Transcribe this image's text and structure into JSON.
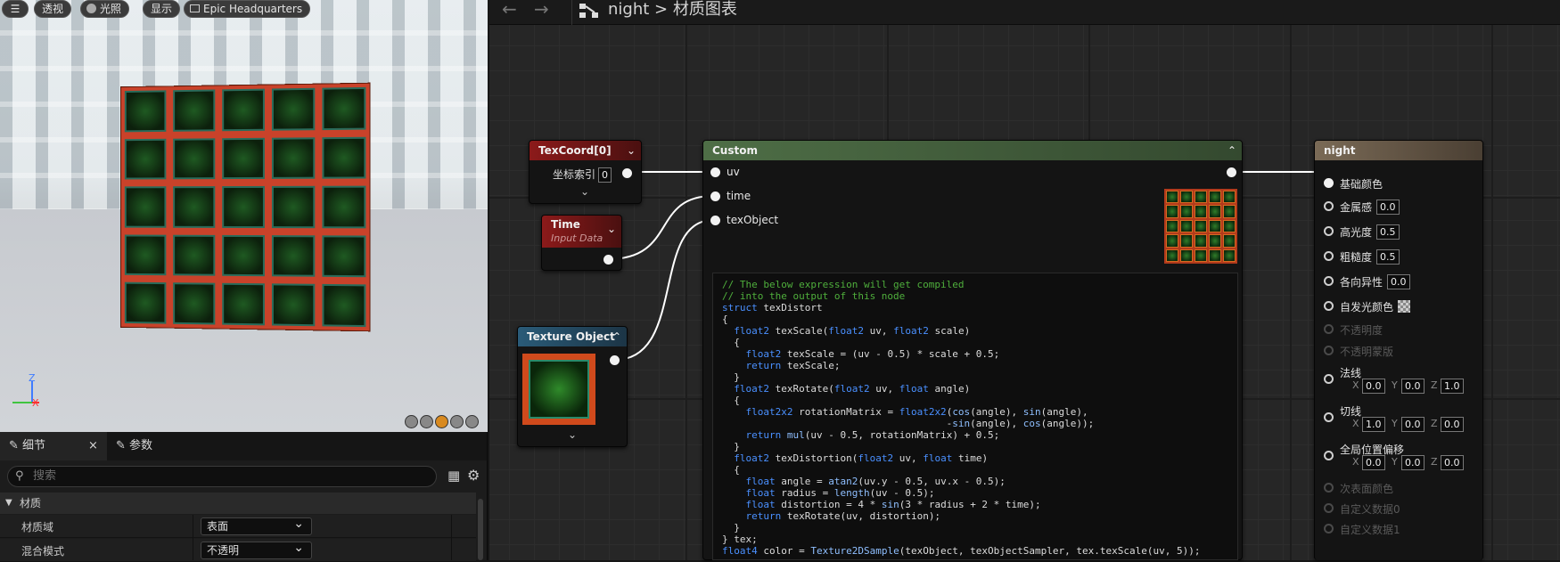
{
  "viewport": {
    "menu_icon": "hamburger-icon",
    "buttons": [
      "透视",
      "光照",
      "显示",
      "Epic Headquarters"
    ],
    "axis": {
      "z": "Z",
      "x": "X"
    }
  },
  "details": {
    "tabs": [
      "细节",
      "参数"
    ],
    "close": "×",
    "search_placeholder": "搜索",
    "category": "材质",
    "rows": [
      {
        "label": "材质域",
        "value": "表面"
      },
      {
        "label": "混合模式",
        "value": "不透明"
      }
    ]
  },
  "graph": {
    "breadcrumb_root": "night",
    "breadcrumb_sep": ">",
    "breadcrumb_current": "材质图表",
    "nodes": {
      "texcoord": {
        "title": "TexCoord[0]",
        "param": "坐标索引",
        "value": "0"
      },
      "time": {
        "title": "Time",
        "subtitle": "Input Data"
      },
      "texobj": {
        "title": "Texture Object"
      },
      "custom": {
        "title": "Custom",
        "inputs": [
          "uv",
          "time",
          "texObject"
        ]
      },
      "result": {
        "title": "night",
        "pins": [
          {
            "label": "基础颜色",
            "value": ""
          },
          {
            "label": "金属感",
            "value": "0.0"
          },
          {
            "label": "高光度",
            "value": "0.5"
          },
          {
            "label": "粗糙度",
            "value": "0.5"
          },
          {
            "label": "各向异性",
            "value": "0.0"
          },
          {
            "label": "自发光颜色",
            "value": ""
          },
          {
            "label": "不透明度",
            "value": ""
          },
          {
            "label": "不透明蒙版",
            "value": ""
          },
          {
            "label": "法线",
            "value": ""
          },
          {
            "label": "切线",
            "value": ""
          },
          {
            "label": "全局位置偏移",
            "value": ""
          },
          {
            "label": "次表面颜色",
            "value": ""
          },
          {
            "label": "自定义数据0",
            "value": ""
          },
          {
            "label": "自定义数据1",
            "value": ""
          }
        ],
        "normal_xyz": [
          "0.0",
          "0.0",
          "1.0"
        ],
        "tangent_xyz": [
          "1.0",
          "0.0",
          "0.0"
        ],
        "wpo_xyz": [
          "0.0",
          "0.0",
          "0.0"
        ],
        "xyz_labels": [
          "X",
          "Y",
          "Z"
        ]
      }
    },
    "code_lines": [
      "// The below expression will get compiled",
      "// into the output of this node",
      "struct texDistort",
      "{",
      "  float2 texScale(float2 uv, float2 scale)",
      "  {",
      "    float2 texScale = (uv - 0.5) * scale + 0.5;",
      "    return texScale;",
      "  }",
      "  float2 texRotate(float2 uv, float angle)",
      "  {",
      "    float2x2 rotationMatrix = float2x2(cos(angle), sin(angle),",
      "                                      -sin(angle), cos(angle));",
      "    return mul(uv - 0.5, rotationMatrix) + 0.5;",
      "  }",
      "  float2 texDistortion(float2 uv, float time)",
      "  {",
      "    float angle = atan2(uv.y - 0.5, uv.x - 0.5);",
      "    float radius = length(uv - 0.5);",
      "    float distortion = 4 * sin(3 * radius + 2 * time);",
      "    return texRotate(uv, distortion);",
      "  }",
      "} tex;",
      "float4 color = Texture2DSample(texObject, texObjectSampler, tex.texScale(uv, 5));"
    ]
  }
}
